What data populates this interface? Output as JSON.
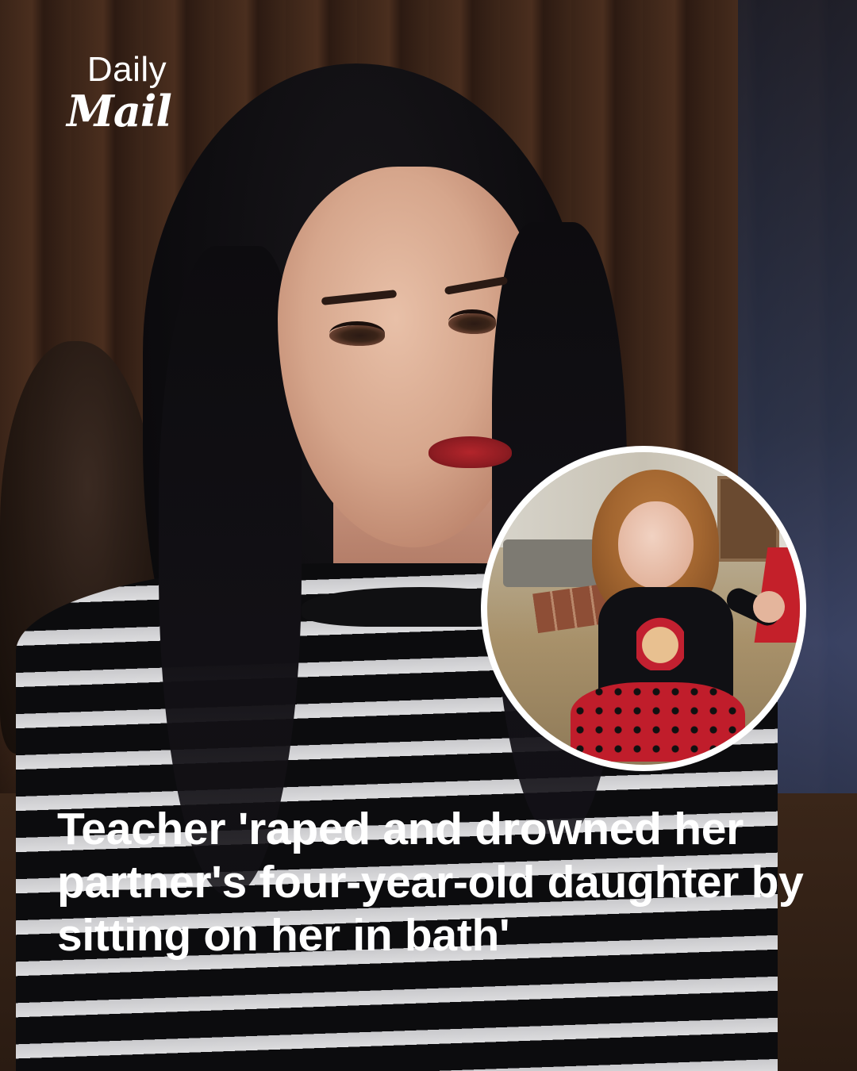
{
  "brand": {
    "line1": "Daily",
    "line2": "Mail"
  },
  "headline": "Teacher 'raped and drowned her partner's four-year-old daughter by sitting on her in bath'",
  "colors": {
    "headline_text": "#ffffff",
    "inset_border": "#ffffff"
  },
  "images": {
    "main_photo": "woman-in-striped-top-in-courtroom",
    "inset_photo": "young-girl-in-minnie-mouse-dress"
  }
}
